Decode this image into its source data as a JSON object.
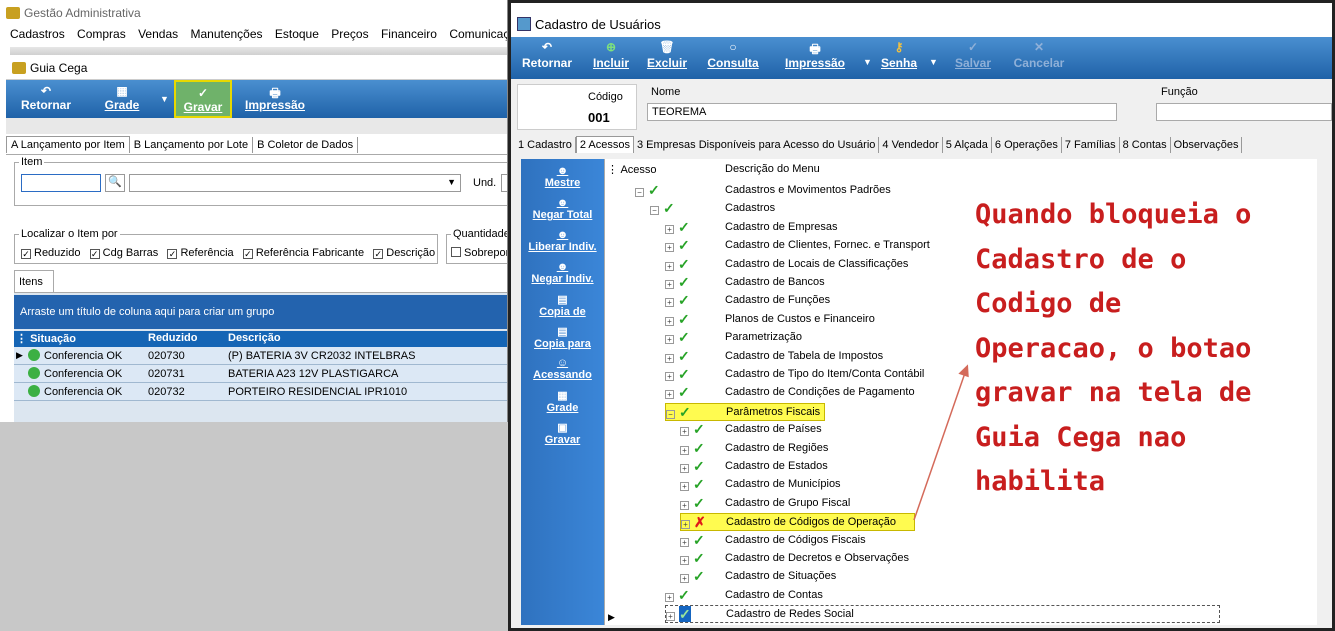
{
  "left_window": {
    "app_title": "Gestão Administrativa",
    "menu": [
      "Cadastros",
      "Compras",
      "Vendas",
      "Manutenções",
      "Estoque",
      "Preços",
      "Financeiro",
      "Comunicação"
    ],
    "child_title": "Guia Cega",
    "toolbar": {
      "retornar": "Retornar",
      "grade": "Grade",
      "gravar": "Gravar",
      "impressao": "Impressão"
    },
    "tabs": [
      "A Lançamento por Item",
      "B Lançamento por Lote",
      "B Coletor de Dados"
    ],
    "item_legend": "Item",
    "und_label": "Und.",
    "localizar_legend": "Localizar o Item por",
    "localizar_options": [
      "Reduzido",
      "Cdg Barras",
      "Referência",
      "Referência Fabricante",
      "Descrição"
    ],
    "quantidade_legend": "Quantidade",
    "sobrepor_label": "Sobrepor",
    "itens_tab": "Itens",
    "group_hint": "Arraste um título de coluna aqui para criar um grupo",
    "columns": [
      "Situação",
      "Reduzido",
      "Descrição"
    ],
    "rows": [
      {
        "situacao": "Conferencia OK",
        "reduzido": "020730",
        "descricao": "(P) BATERIA 3V CR2032 INTELBRAS"
      },
      {
        "situacao": "Conferencia OK",
        "reduzido": "020731",
        "descricao": "BATERIA A23 12V PLASTIGARCA"
      },
      {
        "situacao": "Conferencia OK",
        "reduzido": "020732",
        "descricao": "PORTEIRO RESIDENCIAL IPR1010"
      }
    ]
  },
  "right_window": {
    "title": "Cadastro de Usuários",
    "toolbar": {
      "retornar": "Retornar",
      "incluir": "Incluir",
      "excluir": "Excluir",
      "consulta": "Consulta",
      "impressao": "Impressão",
      "senha": "Senha",
      "salvar": "Salvar",
      "cancelar": "Cancelar"
    },
    "codigo_label": "Código",
    "codigo_value": "001",
    "nome_label": "Nome",
    "nome_value": "TEOREMA",
    "funcao_label": "Função",
    "tabs": [
      "1 Cadastro",
      "2 Acessos",
      "3 Empresas Disponíveis para Acesso do Usuário",
      "4 Vendedor",
      "5 Alçada",
      "6 Operações",
      "7 Famílias",
      "8 Contas",
      "Observações"
    ],
    "sidenav": [
      "Mestre",
      "Negar Total",
      "Liberar Indiv.",
      "Negar Indiv.",
      "Copia de",
      "Copia para",
      "Acessando",
      "Grade",
      "Gravar"
    ],
    "tree_header": {
      "acesso": "Acesso",
      "descricao": "Descrição do Menu"
    },
    "tree": [
      "Cadastros e Movimentos Padrões",
      "Cadastros",
      "Cadastro de Empresas",
      "Cadastro de Clientes, Fornec. e Transport",
      "Cadastro de Locais de Classificações",
      "Cadastro de Bancos",
      "Cadastro de Funções",
      "Planos de Custos e Financeiro",
      "Parametrização",
      "Cadastro de Tabela de Impostos",
      "Cadastro de Tipo do Item/Conta Contábil",
      "Cadastro de Condições de Pagamento",
      "Parâmetros Fiscais",
      "Cadastro de Países",
      "Cadastro de Regiões",
      "Cadastro de Estados",
      "Cadastro de Municípios",
      "Cadastro de Grupo Fiscal",
      "Cadastro de Códigos de Operação",
      "Cadastro de Códigos Fiscais",
      "Cadastro de Decretos e Observações",
      "Cadastro de Situações",
      "Cadastro de Contas",
      "Cadastro de Redes Social"
    ]
  },
  "annotation": [
    "Quando bloqueia o",
    "Cadastro de o",
    "Codigo de",
    "Operacao, o botao",
    "gravar na tela de",
    "Guia Cega nao",
    "habilita"
  ]
}
